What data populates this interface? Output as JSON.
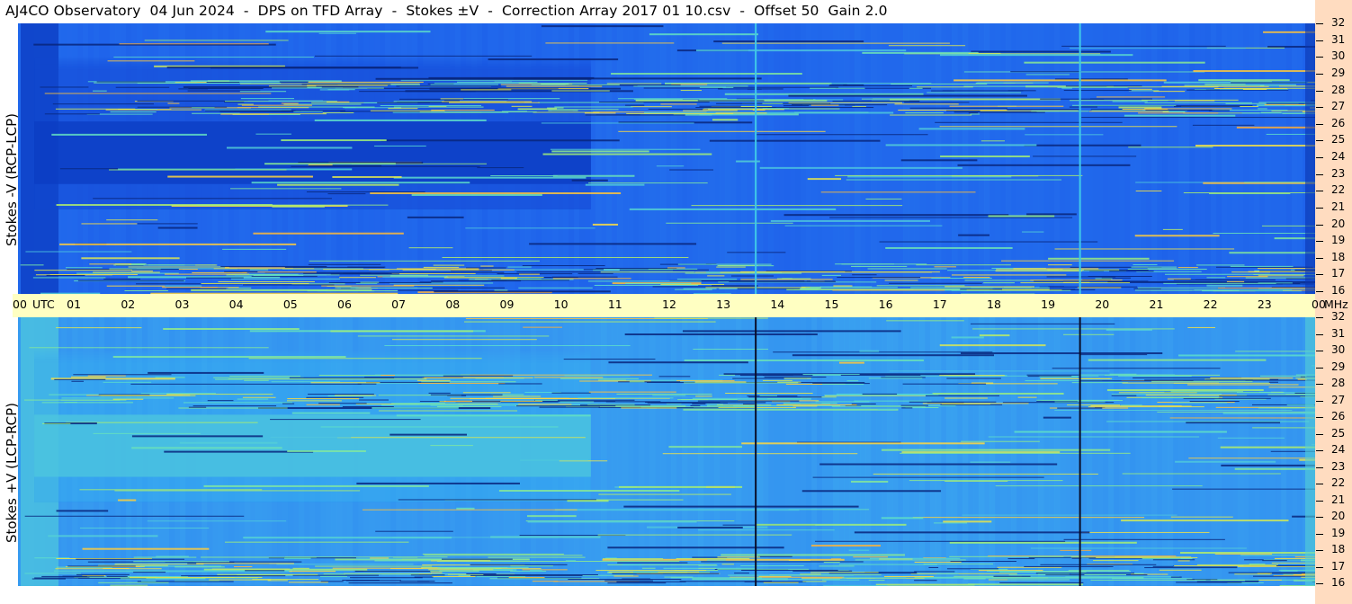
{
  "title": "AJ4CO Observatory  04 Jun 2024  -  DPS on TFD Array  -  Stokes ±V  -  Correction Array 2017 01 10.csv  -  Offset 50  Gain 2.0",
  "chart_data": [
    {
      "type": "heatmap",
      "panel": "top",
      "ylabel": "Stokes -V (RCP-LCP)",
      "x_axis": {
        "unit": "UTC",
        "ticks": [
          "00",
          "01",
          "02",
          "03",
          "04",
          "05",
          "06",
          "07",
          "08",
          "09",
          "10",
          "11",
          "12",
          "13",
          "14",
          "15",
          "16",
          "17",
          "18",
          "19",
          "20",
          "21",
          "22",
          "23",
          "00"
        ],
        "range": [
          0,
          24
        ]
      },
      "y_axis": {
        "unit": "MHz",
        "ticks": [
          "16",
          "17",
          "18",
          "19",
          "20",
          "21",
          "22",
          "23",
          "24",
          "25",
          "26",
          "27",
          "28",
          "29",
          "30",
          "31",
          "32"
        ],
        "range": [
          16,
          32
        ]
      },
      "colormap": [
        "#08226f",
        "#0a3bbf",
        "#1a56e8",
        "#2a7ff0",
        "#3fb0f0",
        "#5fe0c8",
        "#a8f070",
        "#ffe040",
        "#ff8030"
      ],
      "description_values": {
        "background_level": "blue",
        "dark_band_hours": [
          0.3,
          10.6
        ],
        "dark_band_mhz": [
          22.5,
          26.2
        ],
        "vertical_lines_utc": [
          13.65,
          19.65
        ]
      }
    },
    {
      "type": "heatmap",
      "panel": "bottom",
      "ylabel": "Stokes +V (LCP-RCP)",
      "x_axis": {
        "unit": "UTC",
        "ticks": [
          "00",
          "01",
          "02",
          "03",
          "04",
          "05",
          "06",
          "07",
          "08",
          "09",
          "10",
          "11",
          "12",
          "13",
          "14",
          "15",
          "16",
          "17",
          "18",
          "19",
          "20",
          "21",
          "22",
          "23",
          "00"
        ],
        "range": [
          0,
          24
        ]
      },
      "y_axis": {
        "unit": "MHz",
        "ticks": [
          "16",
          "17",
          "18",
          "19",
          "20",
          "21",
          "22",
          "23",
          "24",
          "25",
          "26",
          "27",
          "28",
          "29",
          "30",
          "31",
          "32"
        ],
        "range": [
          16,
          32
        ]
      },
      "colormap": [
        "#08226f",
        "#0a3bbf",
        "#1a56e8",
        "#2a7ff0",
        "#3fb0f0",
        "#5fe0c8",
        "#a8f070",
        "#ffe040",
        "#ff8030"
      ],
      "description_values": {
        "background_level": "light blue",
        "bright_band_hours": [
          0.3,
          10.6
        ],
        "bright_band_mhz": [
          22.5,
          26.2
        ],
        "vertical_lines_utc": [
          13.65,
          19.65
        ]
      }
    }
  ],
  "axis": {
    "utc_label": "UTC",
    "mhz_label": "MHz"
  }
}
